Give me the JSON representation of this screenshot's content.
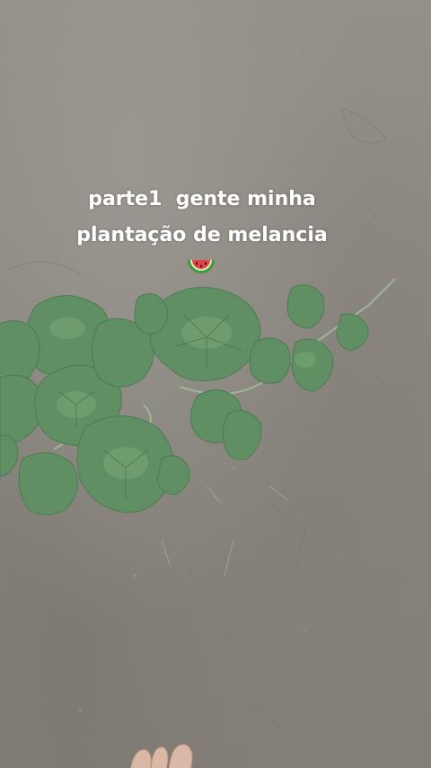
{
  "caption": {
    "line1": "parte1  gente minha",
    "line2": "plantação de melancia"
  },
  "emoji": "watermelon-emoji",
  "colors": {
    "soil": "#8b8780",
    "leaf": "#5f8f63",
    "leaf_light": "#7aa87a",
    "text": "#ffffff"
  }
}
